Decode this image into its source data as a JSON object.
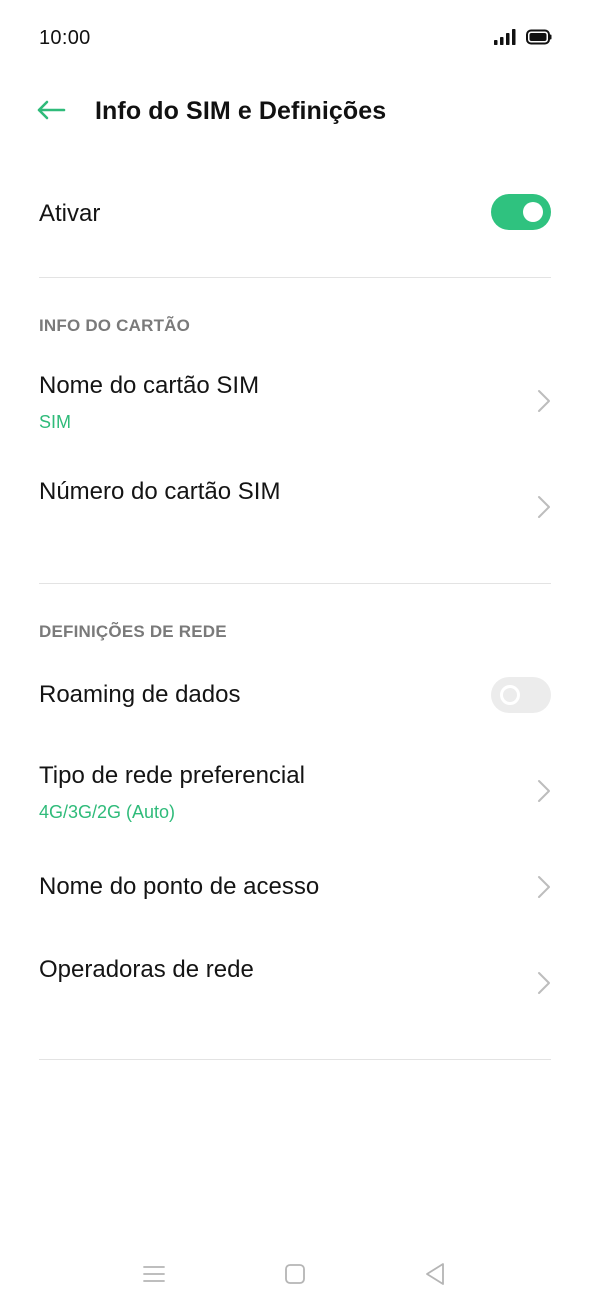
{
  "status_bar": {
    "time": "10:00",
    "icons": [
      "signal-icon",
      "battery-icon"
    ]
  },
  "header": {
    "title": "Info do SIM e Definições",
    "back_icon": "arrow-left-icon"
  },
  "colors": {
    "accent": "#2fbb7a",
    "switch_on": "#2fc27f",
    "switch_off": "#ececec",
    "section_header": "#7a7a7a",
    "divider": "#e3e3e3"
  },
  "activate": {
    "label": "Ativar",
    "enabled": true
  },
  "card_info": {
    "header": "INFO DO CARTÃO",
    "items": [
      {
        "label": "Nome do cartão SIM",
        "value": "SIM"
      },
      {
        "label": "Número do cartão SIM",
        "value": ""
      }
    ]
  },
  "network_settings": {
    "header": "DEFINIÇÕES DE REDE",
    "data_roaming": {
      "label": "Roaming de dados",
      "enabled": false
    },
    "items": [
      {
        "label": "Tipo de rede preferencial",
        "value": "4G/3G/2G (Auto)"
      },
      {
        "label": "Nome do ponto de acesso",
        "value": ""
      },
      {
        "label": "Operadoras de rede",
        "value": ""
      }
    ]
  },
  "nav_bar": {
    "buttons": [
      "menu-icon",
      "home-icon",
      "back-triangle-icon"
    ]
  }
}
